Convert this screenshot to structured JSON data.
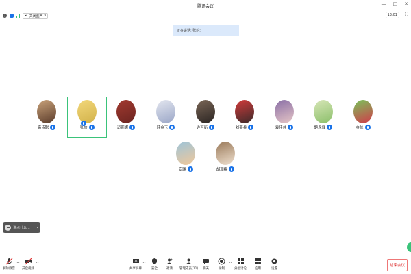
{
  "window": {
    "title": "腾讯会议",
    "controls": [
      "—",
      "□",
      "✕"
    ]
  },
  "top_toolbar": {
    "audio_label": "关闭图声",
    "clock": "13:01"
  },
  "speaking_banner": "正在讲话: 张豹;",
  "participants": [
    {
      "name": "高诗聪",
      "colors": [
        "#5a3b2a",
        "#c9a27a"
      ]
    },
    {
      "name": "张豹",
      "colors": [
        "#d2b24a",
        "#f2d77a"
      ],
      "active": true
    },
    {
      "name": "迈莉娜",
      "colors": [
        "#6b2420",
        "#a23a30"
      ]
    },
    {
      "name": "韩金玉",
      "colors": [
        "#9aa6c7",
        "#e3e6ef"
      ]
    },
    {
      "name": "许可新",
      "colors": [
        "#2a2422",
        "#7a6656"
      ]
    },
    {
      "name": "刘奕兵",
      "colors": [
        "#3a2a2a",
        "#d23b3b"
      ]
    },
    {
      "name": "袁佳伟",
      "colors": [
        "#e6c6c6",
        "#8a6fa6"
      ]
    },
    {
      "name": "鲍永辉",
      "colors": [
        "#8bbf6a",
        "#d7e6b7"
      ]
    },
    {
      "name": "金兰",
      "colors": [
        "#d23b4a",
        "#7ac25a"
      ]
    },
    {
      "name": "安璐",
      "colors": [
        "#f1c89a",
        "#9ec4d8"
      ]
    },
    {
      "name": "胡珊梅",
      "colors": [
        "#f0e1d0",
        "#9a7a5a"
      ]
    }
  ],
  "chat_popup": {
    "text": "说点什么..."
  },
  "bottom_toolbar": {
    "left": [
      {
        "label": "解除静音"
      },
      {
        "label": "开启视频"
      }
    ],
    "center": [
      {
        "label": "共享屏幕"
      },
      {
        "label": "安全"
      },
      {
        "label": "邀请"
      },
      {
        "label": "管理成员(11)"
      },
      {
        "label": "聊天"
      },
      {
        "label": "录制"
      },
      {
        "label": "分组讨论"
      },
      {
        "label": "应用"
      },
      {
        "label": "设置"
      }
    ],
    "end_meeting": "结束会议"
  }
}
